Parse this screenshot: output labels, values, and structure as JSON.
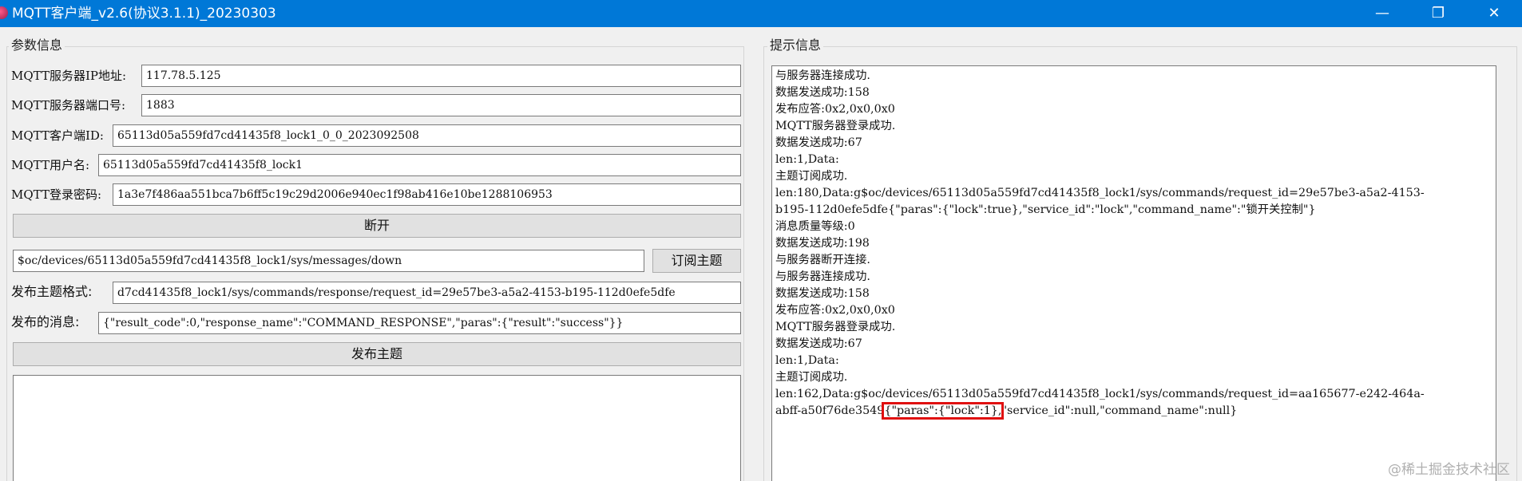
{
  "window": {
    "title": "MQTT客户端_v2.6(协议3.1.1)_20230303",
    "min_symbol": "—",
    "max_symbol": "❐",
    "close_symbol": "✕"
  },
  "params": {
    "group_label": "参数信息",
    "server_ip_label": "MQTT服务器IP地址:",
    "server_ip": "117.78.5.125",
    "server_port_label": "MQTT服务器端口号:",
    "server_port": "1883",
    "client_id_label": "MQTT客户端ID:",
    "client_id": "65113d05a559fd7cd41435f8_lock1_0_0_2023092508",
    "username_label": "MQTT用户名:",
    "username": "65113d05a559fd7cd41435f8_lock1",
    "password_label": "MQTT登录密码:",
    "password": "1a3e7f486aa551bca7b6ff5c19c29d2006e940ec1f98ab416e10be1288106953",
    "disconnect_button": "断开",
    "subscribe_topic": "$oc/devices/65113d05a559fd7cd41435f8_lock1/sys/messages/down",
    "subscribe_button": "订阅主题",
    "publish_topic_label": "发布主题格式:",
    "publish_topic": "d7cd41435f8_lock1/sys/commands/response/request_id=29e57be3-a5a2-4153-b195-112d0efe5dfe",
    "publish_message_label": "发布的消息:",
    "publish_message": "{\"result_code\":0,\"response_name\":\"COMMAND_RESPONSE\",\"paras\":{\"result\":\"success\"}}",
    "publish_button": "发布主题"
  },
  "log": {
    "group_label": "提示信息",
    "lines": [
      "与服务器连接成功.",
      "数据发送成功:158",
      "发布应答:0x2,0x0,0x0",
      "MQTT服务器登录成功.",
      "数据发送成功:67",
      "len:1,Data:",
      "主题订阅成功.",
      "len:180,Data:g$oc/devices/65113d05a559fd7cd41435f8_lock1/sys/commands/request_id=29e57be3-a5a2-4153-",
      "b195-112d0efe5dfe{\"paras\":{\"lock\":true},\"service_id\":\"lock\",\"command_name\":\"锁开关控制\"}",
      "消息质量等级:0",
      "数据发送成功:198",
      "与服务器断开连接.",
      "与服务器连接成功.",
      "数据发送成功:158",
      "发布应答:0x2,0x0,0x0",
      "MQTT服务器登录成功.",
      "数据发送成功:67",
      "len:1,Data:",
      "主题订阅成功.",
      "len:162,Data:g$oc/devices/65113d05a559fd7cd41435f8_lock1/sys/commands/request_id=aa165677-e242-464a-"
    ],
    "last_line_prefix": "abff-a50f76de3549",
    "last_line_highlight": "{\"paras\":{\"lock\":1},",
    "last_line_suffix": "\"service_id\":null,\"command_name\":null}"
  },
  "watermark": "@稀土掘金技术社区"
}
